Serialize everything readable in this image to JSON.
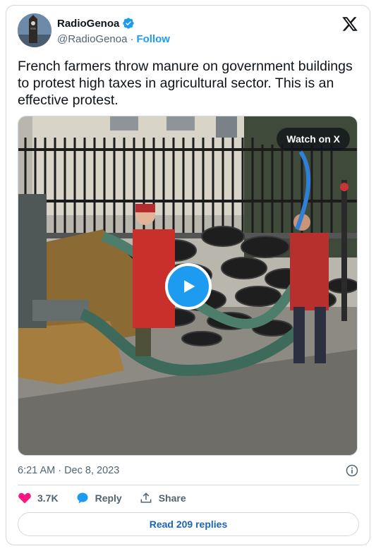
{
  "author": {
    "display_name": "RadioGenoa",
    "handle": "@RadioGenoa",
    "separator": "·",
    "follow_label": "Follow",
    "verified": true
  },
  "tweet": {
    "text": "French farmers throw manure on government buildings to protest high taxes in agricultural sector. This is an effective protest."
  },
  "media": {
    "type": "video",
    "watch_label": "Watch on X"
  },
  "meta": {
    "timestamp": "6:21 AM · Dec 8, 2023"
  },
  "actions": {
    "like_count": "3.7K",
    "reply_label": "Reply",
    "share_label": "Share"
  },
  "footer": {
    "read_replies_label": "Read 209 replies"
  },
  "colors": {
    "accent": "#1d9bf0",
    "like": "#f91880",
    "link": "#1d66b0"
  }
}
